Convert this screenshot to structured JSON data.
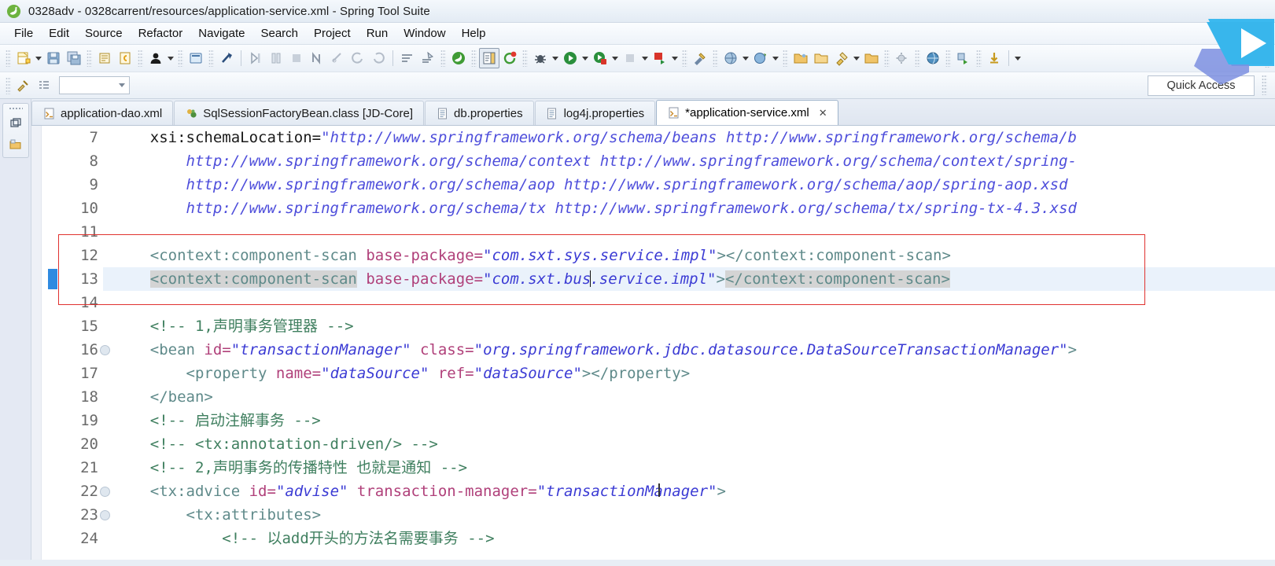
{
  "window": {
    "title": "0328adv - 0328carrent/resources/application-service.xml - Spring Tool Suite",
    "logo_icon": "spring-tool-suite-icon"
  },
  "menubar": {
    "items": [
      {
        "label": "File"
      },
      {
        "label": "Edit"
      },
      {
        "label": "Source"
      },
      {
        "label": "Refactor"
      },
      {
        "label": "Navigate"
      },
      {
        "label": "Search"
      },
      {
        "label": "Project"
      },
      {
        "label": "Run"
      },
      {
        "label": "Window"
      },
      {
        "label": "Help"
      }
    ]
  },
  "toolbar": {
    "quick_access_label": "Quick Access",
    "combo_value": "",
    "buttons": [
      {
        "name": "new-wizard-icon"
      },
      {
        "name": "save-icon"
      },
      {
        "name": "save-all-icon"
      },
      {
        "name": "print-icon"
      },
      {
        "name": "undo-history-icon"
      },
      {
        "name": "user-icon"
      },
      {
        "name": "console-icon"
      },
      {
        "name": "link-break-icon"
      },
      {
        "name": "step-into-icon"
      },
      {
        "name": "step-over-icon"
      },
      {
        "name": "terminate-icon"
      },
      {
        "name": "next-annotation-icon"
      },
      {
        "name": "previous-edit-icon"
      },
      {
        "name": "back-icon"
      },
      {
        "name": "forward-icon"
      },
      {
        "name": "sort-icon"
      },
      {
        "name": "validate-icon"
      },
      {
        "name": "spring-icon"
      },
      {
        "name": "bean-config-icon"
      },
      {
        "name": "refresh-icon"
      },
      {
        "name": "debug-icon"
      },
      {
        "name": "run-icon"
      },
      {
        "name": "run-server-icon"
      },
      {
        "name": "stop-icon"
      },
      {
        "name": "deploy-icon"
      },
      {
        "name": "build-icon"
      },
      {
        "name": "package-explorer-icon"
      },
      {
        "name": "search-globe-icon"
      },
      {
        "name": "open-folder-icon"
      },
      {
        "name": "open-type-icon"
      },
      {
        "name": "rocket-icon"
      },
      {
        "name": "open-resource-icon"
      },
      {
        "name": "settings-icon"
      },
      {
        "name": "globe-icon"
      },
      {
        "name": "perspective-icon"
      },
      {
        "name": "download-icon"
      }
    ]
  },
  "fastview": {
    "items": [
      {
        "name": "restore-view-icon"
      },
      {
        "name": "package-explorer-fastview-icon"
      }
    ]
  },
  "editor_tabs": [
    {
      "label": "application-dao.xml",
      "icon": "xml-file-icon",
      "active": false,
      "dirty": false
    },
    {
      "label": "SqlSessionFactoryBean.class [JD-Core]",
      "icon": "class-file-icon",
      "active": false,
      "dirty": false
    },
    {
      "label": "db.properties",
      "icon": "properties-file-icon",
      "active": false,
      "dirty": false
    },
    {
      "label": "log4j.properties",
      "icon": "properties-file-icon",
      "active": false,
      "dirty": false
    },
    {
      "label": "*application-service.xml",
      "icon": "xml-file-icon",
      "active": true,
      "dirty": true,
      "close_glyph": "✕"
    }
  ],
  "editor": {
    "current_line": 13,
    "lines": [
      {
        "number": "7",
        "fold": false,
        "segments": [
          {
            "t": "    ",
            "c": "plain"
          },
          {
            "t": "xsi:schemaLocation=",
            "c": "plain"
          },
          {
            "t": "\"http://www.springframework.org/schema/beans http://www.springframework.org/schema/b",
            "c": "lnk"
          }
        ]
      },
      {
        "number": "8",
        "fold": false,
        "segments": [
          {
            "t": "        ",
            "c": "plain"
          },
          {
            "t": "http://www.springframework.org/schema/context http://www.springframework.org/schema/context/spring-",
            "c": "lnk"
          }
        ]
      },
      {
        "number": "9",
        "fold": false,
        "segments": [
          {
            "t": "        ",
            "c": "plain"
          },
          {
            "t": "http://www.springframework.org/schema/aop http://www.springframework.org/schema/aop/spring-aop.xsd",
            "c": "lnk"
          }
        ]
      },
      {
        "number": "10",
        "fold": false,
        "segments": [
          {
            "t": "        ",
            "c": "plain"
          },
          {
            "t": "http://www.springframework.org/schema/tx http://www.springframework.org/schema/tx/spring-tx-4.3.xsd",
            "c": "lnk"
          }
        ]
      },
      {
        "number": "11",
        "fold": false,
        "segments": []
      },
      {
        "number": "12",
        "fold": false,
        "segments": [
          {
            "t": "    ",
            "c": "plain"
          },
          {
            "t": "<context:component-scan",
            "c": "tag"
          },
          {
            "t": " ",
            "c": "plain"
          },
          {
            "t": "base-package=",
            "c": "attr"
          },
          {
            "t": "\"com.sxt.sys.service.impl\"",
            "c": "str"
          },
          {
            "t": "></context:component-scan>",
            "c": "tag"
          }
        ]
      },
      {
        "number": "13",
        "fold": false,
        "current": true,
        "segments": [
          {
            "t": "    ",
            "c": "plain"
          },
          {
            "t": "<context:component-scan",
            "c": "tag",
            "occurrence": true
          },
          {
            "t": " ",
            "c": "plain"
          },
          {
            "t": "base-package=",
            "c": "attr"
          },
          {
            "t": "\"com.sxt.bus",
            "c": "str"
          },
          {
            "t": "",
            "c": "caret"
          },
          {
            "t": ".service.impl\"",
            "c": "str"
          },
          {
            "t": ">",
            "c": "tag"
          },
          {
            "t": "</context:component-scan>",
            "c": "tag",
            "occurrence": true
          }
        ]
      },
      {
        "number": "14",
        "fold": false,
        "segments": []
      },
      {
        "number": "15",
        "fold": false,
        "segments": [
          {
            "t": "    ",
            "c": "plain"
          },
          {
            "t": "<!-- 1,声明事务管理器 -->",
            "c": "cmt"
          }
        ]
      },
      {
        "number": "16",
        "fold": true,
        "segments": [
          {
            "t": "    ",
            "c": "plain"
          },
          {
            "t": "<bean",
            "c": "tag"
          },
          {
            "t": " ",
            "c": "plain"
          },
          {
            "t": "id=",
            "c": "attr"
          },
          {
            "t": "\"transactionManager\"",
            "c": "str"
          },
          {
            "t": " ",
            "c": "plain"
          },
          {
            "t": "class=",
            "c": "attr"
          },
          {
            "t": "\"org.springframework.jdbc.datasource.DataSourceTransactionManager\"",
            "c": "str"
          },
          {
            "t": ">",
            "c": "tag"
          }
        ]
      },
      {
        "number": "17",
        "fold": false,
        "segments": [
          {
            "t": "        ",
            "c": "plain"
          },
          {
            "t": "<property",
            "c": "tag"
          },
          {
            "t": " ",
            "c": "plain"
          },
          {
            "t": "name=",
            "c": "attr"
          },
          {
            "t": "\"dataSource\"",
            "c": "str"
          },
          {
            "t": " ",
            "c": "plain"
          },
          {
            "t": "ref=",
            "c": "attr"
          },
          {
            "t": "\"dataSource\"",
            "c": "str"
          },
          {
            "t": "></property>",
            "c": "tag"
          }
        ]
      },
      {
        "number": "18",
        "fold": false,
        "segments": [
          {
            "t": "    ",
            "c": "plain"
          },
          {
            "t": "</bean>",
            "c": "tag"
          }
        ]
      },
      {
        "number": "19",
        "fold": false,
        "segments": [
          {
            "t": "    ",
            "c": "plain"
          },
          {
            "t": "<!-- 启动注解事务 -->",
            "c": "cmt"
          }
        ]
      },
      {
        "number": "20",
        "fold": false,
        "segments": [
          {
            "t": "    ",
            "c": "plain"
          },
          {
            "t": "<!-- <tx:annotation-driven/> -->",
            "c": "cmt"
          }
        ]
      },
      {
        "number": "21",
        "fold": false,
        "segments": [
          {
            "t": "    ",
            "c": "plain"
          },
          {
            "t": "<!-- 2,声明事务的传播特性 也就是通知 -->",
            "c": "cmt"
          }
        ]
      },
      {
        "number": "22",
        "fold": true,
        "segments": [
          {
            "t": "    ",
            "c": "plain"
          },
          {
            "t": "<tx:advice",
            "c": "tag"
          },
          {
            "t": " ",
            "c": "plain"
          },
          {
            "t": "id=",
            "c": "attr"
          },
          {
            "t": "\"advise\"",
            "c": "str"
          },
          {
            "t": " ",
            "c": "plain"
          },
          {
            "t": "transaction-manager=",
            "c": "attr"
          },
          {
            "t": "\"transactionManager\"",
            "c": "str"
          },
          {
            "t": ">",
            "c": "tag"
          }
        ]
      },
      {
        "number": "23",
        "fold": true,
        "segments": [
          {
            "t": "        ",
            "c": "plain"
          },
          {
            "t": "<tx:attributes>",
            "c": "tag"
          }
        ]
      },
      {
        "number": "24",
        "fold": false,
        "segments": [
          {
            "t": "            ",
            "c": "plain"
          },
          {
            "t": "<!-- 以add开头的方法名需要事务 -->",
            "c": "cmt"
          }
        ]
      }
    ]
  },
  "annotations": {
    "highlight_box": {
      "name": "red-highlight-box",
      "color": "#e0322f"
    },
    "cursor_overlay": {
      "name": "blue-play-arrow-overlay",
      "color": "#30b3e8"
    }
  },
  "colors": {
    "accent": "#2f8ae0",
    "red_box": "#e0322f",
    "string": "#3b3bd4",
    "tag": "#5f8a8a",
    "attribute": "#b0407a",
    "comment": "#3f7f5f"
  }
}
